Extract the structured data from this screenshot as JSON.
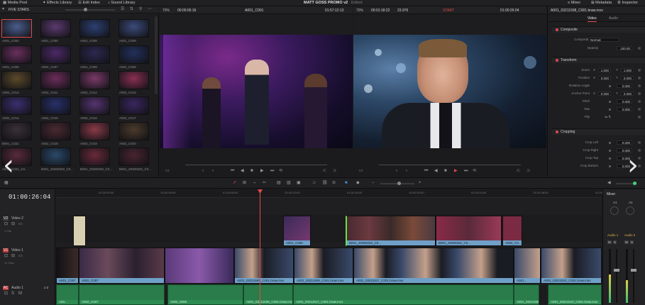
{
  "app": {
    "project_title": "MATT GOSS PROMO v2",
    "edited_label": "Edited",
    "top_left": [
      {
        "label": "Media Pool",
        "icon": "media-pool-icon"
      },
      {
        "label": "Effects Library",
        "icon": "effects-icon"
      },
      {
        "label": "Edit Index",
        "icon": "edit-index-icon"
      },
      {
        "label": "Sound Library",
        "icon": "sound-library-icon"
      }
    ],
    "top_right": [
      {
        "label": "Mixer",
        "icon": "mixer-icon"
      },
      {
        "label": "Metadata",
        "icon": "metadata-icon"
      },
      {
        "label": "Inspector",
        "icon": "inspector-icon"
      }
    ]
  },
  "media_pool": {
    "bin_name": "FIVE STARS",
    "captions": [
      [
        "A001_C004",
        "A001_C005",
        "A001_C008",
        "A001_C009"
      ],
      [
        "A001_C006",
        "A002_C007",
        "A001_C008",
        "A002_C009"
      ],
      [
        "A002_C013",
        "A002_C011",
        "A002_C012",
        "A002_C013"
      ],
      [
        "A002_C014",
        "A002_C015",
        "A002_C016",
        "A002_C017"
      ],
      [
        "B001_C021",
        "A002_C018",
        "A002_C019",
        "A002_C020"
      ],
      [
        "A001_C021_C0...",
        "B001_20300202_C0...",
        "B001_20300202_C0...",
        "B001_20300202_C0..."
      ]
    ],
    "colors": [
      [
        "#4a5d8c",
        "#5b3a6e",
        "#2d3f72",
        "#3b4a7a"
      ],
      [
        "#6a2f5e",
        "#4c2a68",
        "#2c2850",
        "#22305c"
      ],
      [
        "#5c4a2a",
        "#6b2d5a",
        "#7a3a68",
        "#8a2f52"
      ],
      [
        "#3c2f70",
        "#28306a",
        "#553470",
        "#3a2660"
      ],
      [
        "#3a3038",
        "#4a2a30",
        "#8a3a48",
        "#4c3a2a"
      ],
      [
        "#5a2a3a",
        "#2a4a6a",
        "#6a2a3a",
        "#4a2430"
      ]
    ]
  },
  "source_viewer": {
    "zoom": "70%",
    "timecode_in": "00:00:05:16",
    "clip_name": "A001_C001",
    "timecode_out": "01:57:12:13"
  },
  "timeline_viewer": {
    "zoom": "70%",
    "duration": "00:01:18:22",
    "fps": "23.976",
    "marker": "START",
    "timecode": "01:00:26:04",
    "clip_name": "A001_03211508_C001.braw.mov"
  },
  "inspector": {
    "tabs": [
      "Video",
      "Audio"
    ],
    "active_tab": "Video",
    "sections": {
      "composite": "Composite",
      "transform": "Transform",
      "cropping": "Cropping"
    },
    "composite_rows": [
      {
        "label": "Composite Mode",
        "value": "Normal"
      },
      {
        "label": "Opacity",
        "value": "100.00"
      }
    ],
    "transform_rows": [
      {
        "label": "Zoom",
        "x_label": "X",
        "x": "1.000",
        "y_label": "Y",
        "y": "1.000"
      },
      {
        "label": "Position",
        "x_label": "X",
        "x": "0.000",
        "y_label": "Y",
        "y": "0.000"
      },
      {
        "label": "Rotation Angle",
        "value": "0.000"
      },
      {
        "label": "Anchor Point",
        "x_label": "X",
        "x": "0.000",
        "y_label": "Y",
        "y": "0.000"
      },
      {
        "label": "Pitch",
        "value": "0.000"
      },
      {
        "label": "Yaw",
        "value": "0.000"
      },
      {
        "label": "Flip",
        "value": ""
      }
    ],
    "cropping_rows": [
      {
        "label": "Crop Left",
        "value": "0.000"
      },
      {
        "label": "Crop Right",
        "value": "0.000"
      },
      {
        "label": "Crop Top",
        "value": "0.000"
      },
      {
        "label": "Crop Bottom",
        "value": "0.000"
      }
    ]
  },
  "timeline": {
    "timecode": "01:00:26:04",
    "ruler_ticks": [
      "01:00:00:00",
      "01:00:04:00",
      "01:00:08:00",
      "01:00:12:00",
      "01:00:16:00",
      "01:00:20:00",
      "01:00:24:00",
      "01:00:28:00",
      "01:00:32:00",
      "01:00:36:00",
      "01:00:40:00"
    ],
    "tracks": {
      "v2": {
        "id": "V2",
        "name": "Video 2",
        "clips": "1 Clip"
      },
      "v1": {
        "id": "V1",
        "name": "Video 1",
        "clips": "11 Clips"
      },
      "a1": {
        "id": "A1",
        "name": "Audio 1",
        "level": "2.0"
      }
    },
    "v2_clips": [
      "A001_C005",
      "B001_20300202_C0...",
      "B001_20300202_C0...",
      "A002_C0..."
    ],
    "v1_clips": [
      "A001_C007",
      "A002_C007",
      "A001_03211509_C001.braw.mov",
      "A001_03211508_C001.braw.mov",
      "A001_03211517_C001.braw.mov",
      "A001...",
      "A001_03211510_C001.braw.mov"
    ],
    "a1_clips": [
      "A00...",
      "A002_C007",
      "A002_0008",
      "A001_03211508_C001.braw.mov",
      "A001_03211517_C001.braw.mov",
      "A001_03211509_C001...",
      "A001_03211510_C001.braw.mov"
    ]
  },
  "mixer": {
    "title": "Mixer",
    "strips": [
      "A1",
      "A2"
    ],
    "strip_labels": [
      "Audio 1",
      "Audio 2"
    ],
    "main_label": "M1",
    "buttons": [
      "M",
      "S",
      "R"
    ]
  }
}
